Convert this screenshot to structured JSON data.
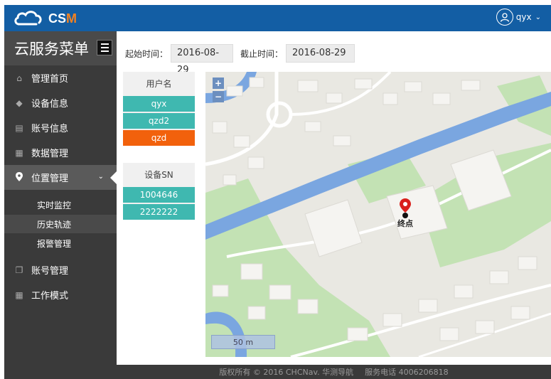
{
  "app": {
    "logo_text_main": "CS",
    "logo_text_accent": "M"
  },
  "user": {
    "name": "qyx"
  },
  "sidebar": {
    "title": "云服务菜单",
    "items": [
      {
        "label": "管理首页",
        "icon": "home-icon"
      },
      {
        "label": "设备信息",
        "icon": "tag-icon"
      },
      {
        "label": "账号信息",
        "icon": "card-icon"
      },
      {
        "label": "数据管理",
        "icon": "table-icon"
      },
      {
        "label": "位置管理",
        "icon": "map-pin-icon",
        "active": true
      },
      {
        "label": "账号管理",
        "icon": "copy-icon"
      },
      {
        "label": "工作模式",
        "icon": "grid-icon"
      }
    ],
    "subitems": [
      {
        "label": "实时监控"
      },
      {
        "label": "历史轨迹",
        "selected": true
      },
      {
        "label": "报警管理"
      }
    ]
  },
  "filters": {
    "start_label": "起始时间：",
    "start_value": "2016-08-29",
    "end_label": "截止时间：",
    "end_value": "2016-08-29"
  },
  "users_list": {
    "header": "用户名",
    "items": [
      "qyx",
      "qzd2",
      "qzd"
    ],
    "selected": "qzd"
  },
  "devices_list": {
    "header": "设备SN",
    "items": [
      "1004646",
      "2222222"
    ]
  },
  "map": {
    "zoom_in": "+",
    "zoom_out": "−",
    "scale_label": "50 m",
    "marker_label": "终点",
    "colors": {
      "land": "#e9e8e2",
      "water": "#7aa6e0",
      "park": "#bfe0b0",
      "building": "#f5f4f1",
      "road": "#ffffff"
    }
  },
  "footer": {
    "copyright": "版权所有 © 2016 CHCNav. 华测导航",
    "phone": "服务电话 4006206818"
  },
  "colors": {
    "topbar": "#135ea4",
    "sidebar": "#3a3a3a",
    "teal": "#3fb8b0",
    "orange": "#f2610c",
    "marker": "#d9201c"
  }
}
